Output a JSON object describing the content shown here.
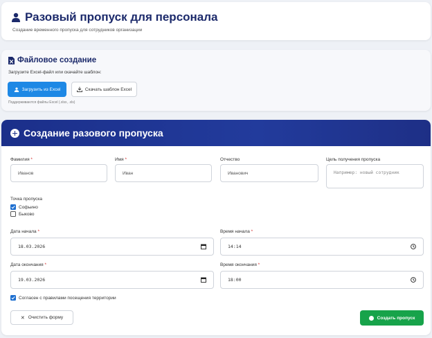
{
  "header": {
    "title": "Разовый пропуск для персонала",
    "subtitle": "Создание временного пропуска для сотрудников организации"
  },
  "file_section": {
    "title": "Файловое создание",
    "label": "Загрузите Excel-файл или скачайте шаблон:",
    "upload_button": "Загрузить из Excel",
    "template_button": "Скачать шаблон Excel",
    "note": "Поддерживаются файлы Excel (.xlsx, .xls)"
  },
  "form": {
    "title": "Создание разового пропуска",
    "surname": {
      "label": "Фамилия",
      "value": "Иванов"
    },
    "name": {
      "label": "Имя",
      "value": "Иван"
    },
    "patronymic": {
      "label": "Отчество",
      "value": "Иванович"
    },
    "purpose": {
      "label": "Цель получения пропуска",
      "placeholder": "Например: новый сотрудник"
    },
    "required_mark": "*",
    "checkpoint": {
      "label": "Точка пропуска",
      "options": [
        {
          "label": "Софьино",
          "checked": true
        },
        {
          "label": "Быково",
          "checked": false
        }
      ]
    },
    "start_date": {
      "label": "Дата начала",
      "value": "18.03.2026"
    },
    "start_time": {
      "label": "Время начала",
      "value": "14:14"
    },
    "end_date": {
      "label": "Дата окончания",
      "value": "19.03.2026"
    },
    "end_time": {
      "label": "Время окончания",
      "value": "18:00"
    },
    "agree": {
      "label": "Согласен с правилами посещения территории",
      "checked": true
    },
    "clear_button": "Очистить форму",
    "create_button": "Создать пропуск"
  },
  "colors": {
    "brand": "#1c2a6b",
    "form_header": "#1b2f8a",
    "primary": "#1e88e5",
    "success": "#17a34a",
    "required": "#d32f2f"
  }
}
